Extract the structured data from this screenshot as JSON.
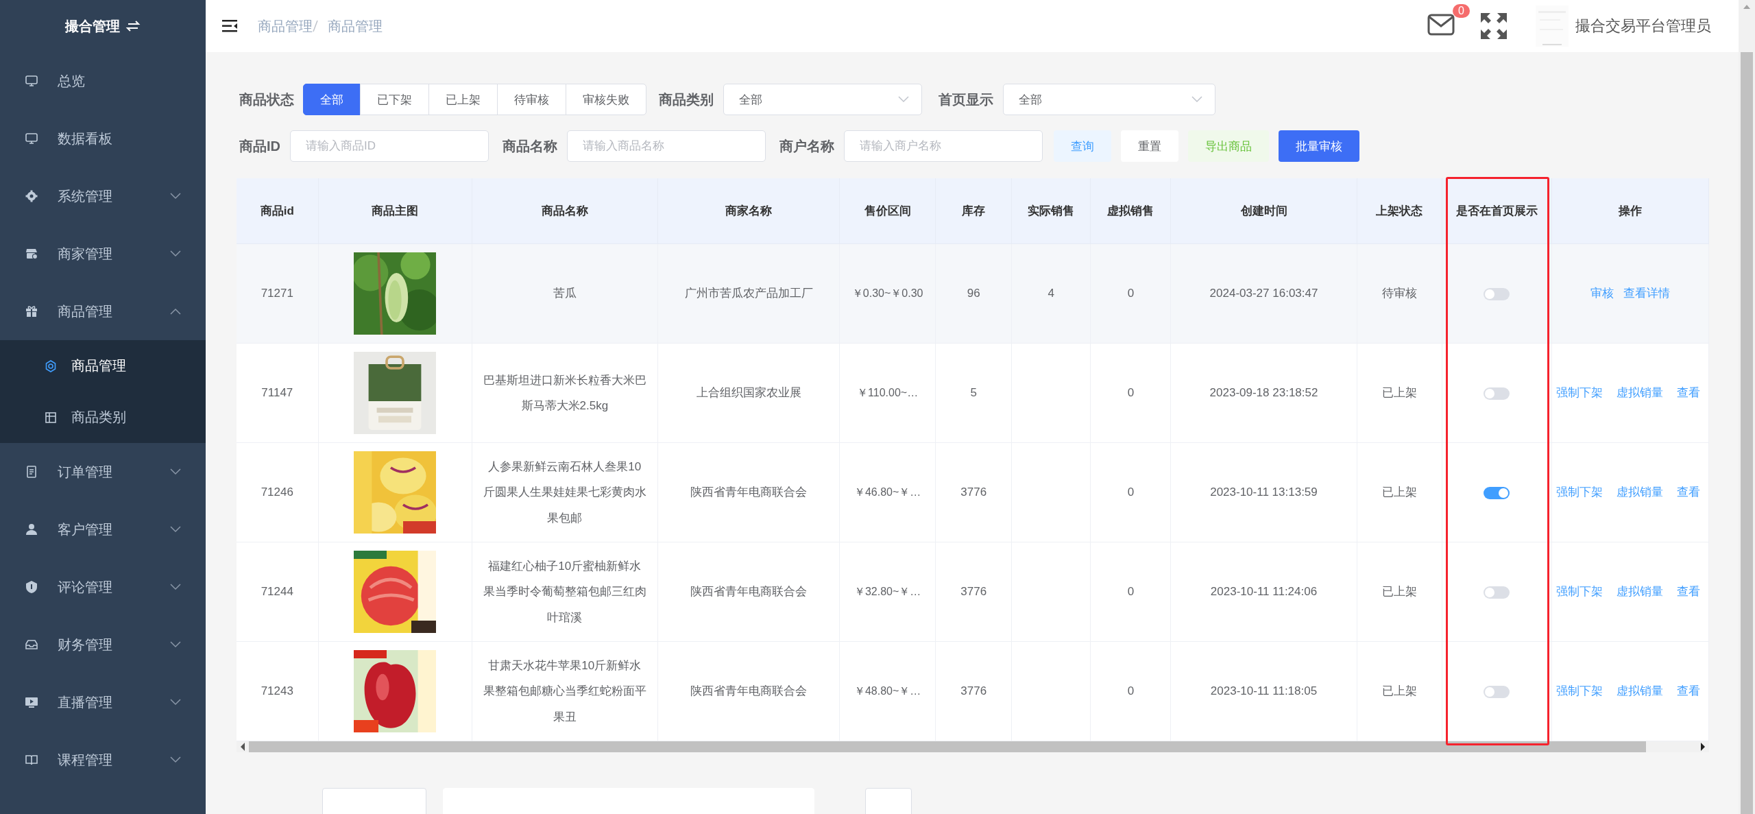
{
  "sidebar": {
    "title": "撮合管理",
    "items": [
      {
        "label": "总览"
      },
      {
        "label": "数据看板"
      },
      {
        "label": "系统管理",
        "expanded": false
      },
      {
        "label": "商家管理",
        "expanded": false
      },
      {
        "label": "商品管理",
        "expanded": true,
        "children": [
          {
            "label": "商品管理",
            "selected": true
          },
          {
            "label": "商品类别",
            "selected": false
          }
        ]
      },
      {
        "label": "订单管理",
        "expanded": false
      },
      {
        "label": "客户管理",
        "expanded": false
      },
      {
        "label": "评论管理",
        "expanded": false
      },
      {
        "label": "财务管理",
        "expanded": false
      },
      {
        "label": "直播管理",
        "expanded": false
      },
      {
        "label": "课程管理",
        "expanded": false
      }
    ]
  },
  "header": {
    "breadcrumb": [
      "商品管理",
      "商品管理"
    ],
    "mail_badge": "0",
    "user_name": "撮合交易平台管理员"
  },
  "filters": {
    "status_label": "商品状态",
    "status_options": [
      {
        "label": "全部",
        "selected": true
      },
      {
        "label": "已下架",
        "selected": false
      },
      {
        "label": "已上架",
        "selected": false
      },
      {
        "label": "待审核",
        "selected": false
      },
      {
        "label": "审核失败",
        "selected": false
      }
    ],
    "category": {
      "label": "商品类别",
      "value": "全部"
    },
    "home_display": {
      "label": "首页显示",
      "value": "全部"
    },
    "fields": [
      {
        "label": "商品ID",
        "placeholder": "请输入商品ID"
      },
      {
        "label": "商品名称",
        "placeholder": "请输入商品名称"
      },
      {
        "label": "商户名称",
        "placeholder": "请输入商户名称"
      }
    ],
    "buttons": [
      {
        "label": "查询",
        "kind": "query"
      },
      {
        "label": "重置",
        "kind": "reset"
      },
      {
        "label": "导出商品",
        "kind": "export"
      },
      {
        "label": "批量审核",
        "kind": "primary"
      }
    ]
  },
  "table": {
    "columns": [
      {
        "label": "商品id",
        "highlighted": false
      },
      {
        "label": "商品主图",
        "highlighted": false
      },
      {
        "label": "商品名称",
        "highlighted": false
      },
      {
        "label": "商家名称",
        "highlighted": false
      },
      {
        "label": "售价区间",
        "highlighted": false
      },
      {
        "label": "库存",
        "highlighted": false
      },
      {
        "label": "实际销售",
        "highlighted": false
      },
      {
        "label": "虚拟销售",
        "highlighted": false
      },
      {
        "label": "创建时间",
        "highlighted": false
      },
      {
        "label": "上架状态",
        "highlighted": false
      },
      {
        "label": "是否在首页展示",
        "highlighted": true
      },
      {
        "label": "操作",
        "highlighted": false
      }
    ],
    "rows": [
      {
        "hovered": true,
        "id": "71271",
        "image": {
          "kind": "picture"
        },
        "name": "苦瓜",
        "merchant": "广州市苦瓜农产品加工厂",
        "price": "￥0.30~￥0.30",
        "stock": "96",
        "actual_sales": "4",
        "virtual_sales": "0",
        "created": "2024-03-27 16:03:47",
        "status": "待审核",
        "on_home": false,
        "actions": [
          "审核",
          "查看详情"
        ]
      },
      {
        "hovered": false,
        "id": "71147",
        "image": {
          "kind": "picture"
        },
        "name": "巴基斯坦进口新米长粒香大米巴斯马蒂大米2.5kg",
        "merchant": "上合组织国家农业展",
        "price": "￥110.00~…",
        "stock": "5",
        "virtual_sales": "0",
        "created": "2023-09-18 23:18:52",
        "status": "已上架",
        "on_home": false,
        "actions": [
          "强制下架",
          "虚拟销量",
          "查看"
        ]
      },
      {
        "hovered": false,
        "id": "71246",
        "image": {
          "kind": "picture"
        },
        "name": "人参果新鲜云南石林人叁果10斤圆果人生果娃娃果七彩黄肉水果包邮",
        "merchant": "陕西省青年电商联合会",
        "price": "￥46.80~￥…",
        "stock": "3776",
        "virtual_sales": "0",
        "created": "2023-10-11 13:13:59",
        "status": "已上架",
        "on_home": true,
        "actions": [
          "强制下架",
          "虚拟销量",
          "查看"
        ]
      },
      {
        "hovered": false,
        "id": "71244",
        "image": {
          "kind": "picture"
        },
        "name": "福建红心柚子10斤蜜柚新鲜水果当季时令葡萄整箱包邮三红肉叶琯溪",
        "merchant": "陕西省青年电商联合会",
        "price": "￥32.80~￥…",
        "stock": "3776",
        "virtual_sales": "0",
        "created": "2023-10-11 11:24:06",
        "status": "已上架",
        "on_home": false,
        "actions": [
          "强制下架",
          "虚拟销量",
          "查看"
        ]
      },
      {
        "hovered": false,
        "id": "71243",
        "image": {
          "kind": "picture"
        },
        "name": "甘肃天水花牛苹果10斤新鲜水果整箱包邮糖心当季红蛇粉面平果丑",
        "merchant": "陕西省青年电商联合会",
        "price": "￥48.80~￥…",
        "stock": "3776",
        "virtual_sales": "0",
        "created": "2023-10-11 11:18:05",
        "status": "已上架",
        "on_home": false,
        "actions": [
          "强制下架",
          "虚拟销量",
          "查看"
        ]
      }
    ]
  }
}
